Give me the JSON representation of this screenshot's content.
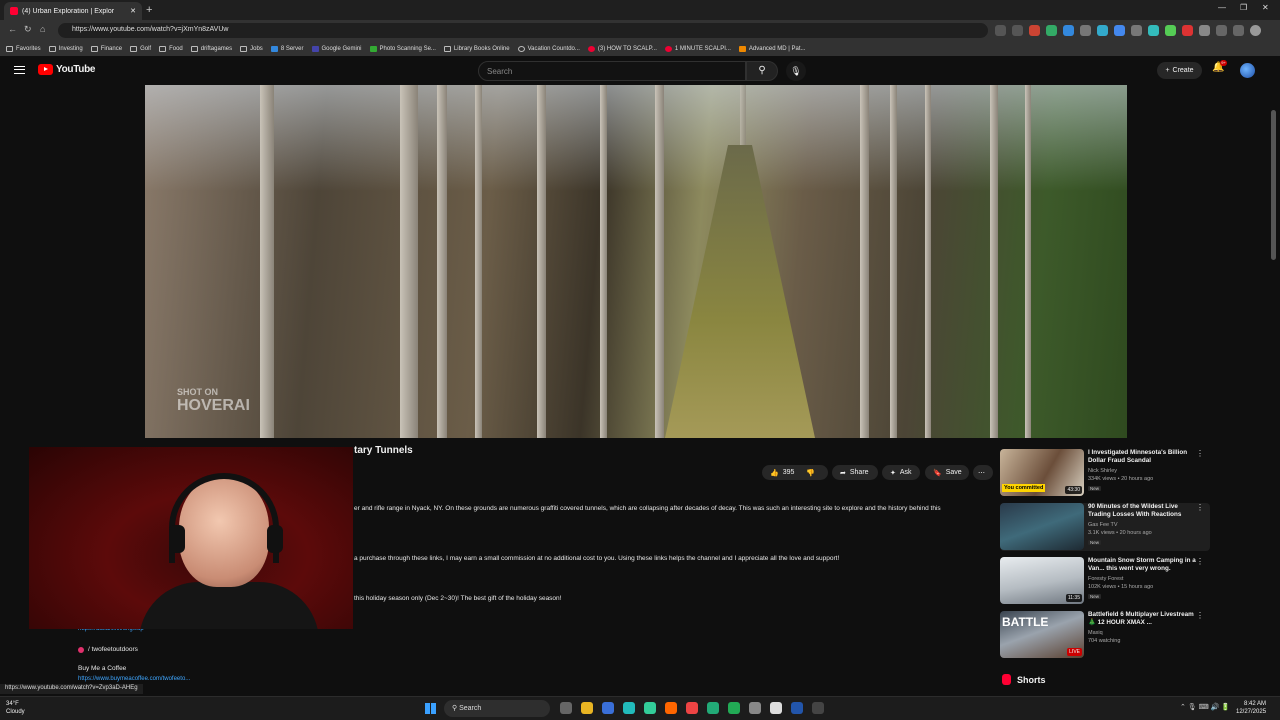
{
  "browser": {
    "tab_title": "(4) Urban Exploration | Explor",
    "url": "https://www.youtube.com/watch?v=jXmYn8zAVUw",
    "bookmarks": [
      "Favorites",
      "Investing",
      "Finance",
      "Golf",
      "Food",
      "driftagames",
      "Jobs",
      "8 Server",
      "Google Gemini",
      "Photo Scanning Se...",
      "Library Books Online",
      "Vacation Countdo...",
      "(3) HOW TO SCALP...",
      "1 MINUTE SCALPI...",
      "Advanced MD | Pat..."
    ]
  },
  "youtube": {
    "logo_text": "YouTube",
    "search_placeholder": "Search",
    "create_label": "Create",
    "notification_count": "9+"
  },
  "video": {
    "watermark_top": "SHOT ON",
    "watermark_bottom": "HOVERAI",
    "title_visible": "tary Tunnels",
    "like_count": "395",
    "share_label": "Share",
    "ask_label": "Ask",
    "save_label": "Save"
  },
  "description": {
    "line1": "er and rifle range in Nyack, NY. On these grounds are numerous graffiti covered tunnels, which are collapsing after decades of decay. This was such an interesting site to explore and the history behind this",
    "line2": "a purchase through these links, I may earn a small commission at no additional cost to you. Using these links helps the channel and I appreciate all the love and support!",
    "line3": "this holiday season only (Dec 2~30)! The best gift of the holiday season!",
    "link1": "https://dakai.link/ongwup",
    "instagram": "/ twofeetoutdoors",
    "coffee_label": "Buy Me a Coffee",
    "coffee_link": "https://www.buymeacoffee.com/twofeeto..."
  },
  "recommendations": [
    {
      "title": "I Investigated Minnesota's Billion Dollar Fraud Scandal",
      "channel": "Nick Shirley",
      "meta": "334K views • 20 hours ago",
      "badge": "New",
      "duration": "43:30",
      "committed": "You committed"
    },
    {
      "title": "90 Minutes of the Wildest Live Trading Losses With Reactions",
      "channel": "Gas Fee TV",
      "meta": "3.1K views • 20 hours ago",
      "badge": "New",
      "duration": ""
    },
    {
      "title": "Mountain Snow Storm Camping in a Van... this went very wrong.",
      "channel": "Foresty Forest",
      "meta": "102K views • 15 hours ago",
      "badge": "New",
      "duration": "11:35"
    },
    {
      "title": "Battlefield 6 Multiplayer Livestream 🎄 12 HOUR XMAX ...",
      "channel": "Maxiq",
      "meta": "704 watching",
      "badge": "",
      "duration": "LIVE"
    }
  ],
  "shorts_label": "Shorts",
  "status_url": "https://www.youtube.com/watch?v=Zvp3aD-AHEg",
  "taskbar": {
    "temp": "34°F",
    "weather": "Cloudy",
    "search_label": "Search",
    "time": "8:42 AM",
    "date": "12/27/2025"
  }
}
